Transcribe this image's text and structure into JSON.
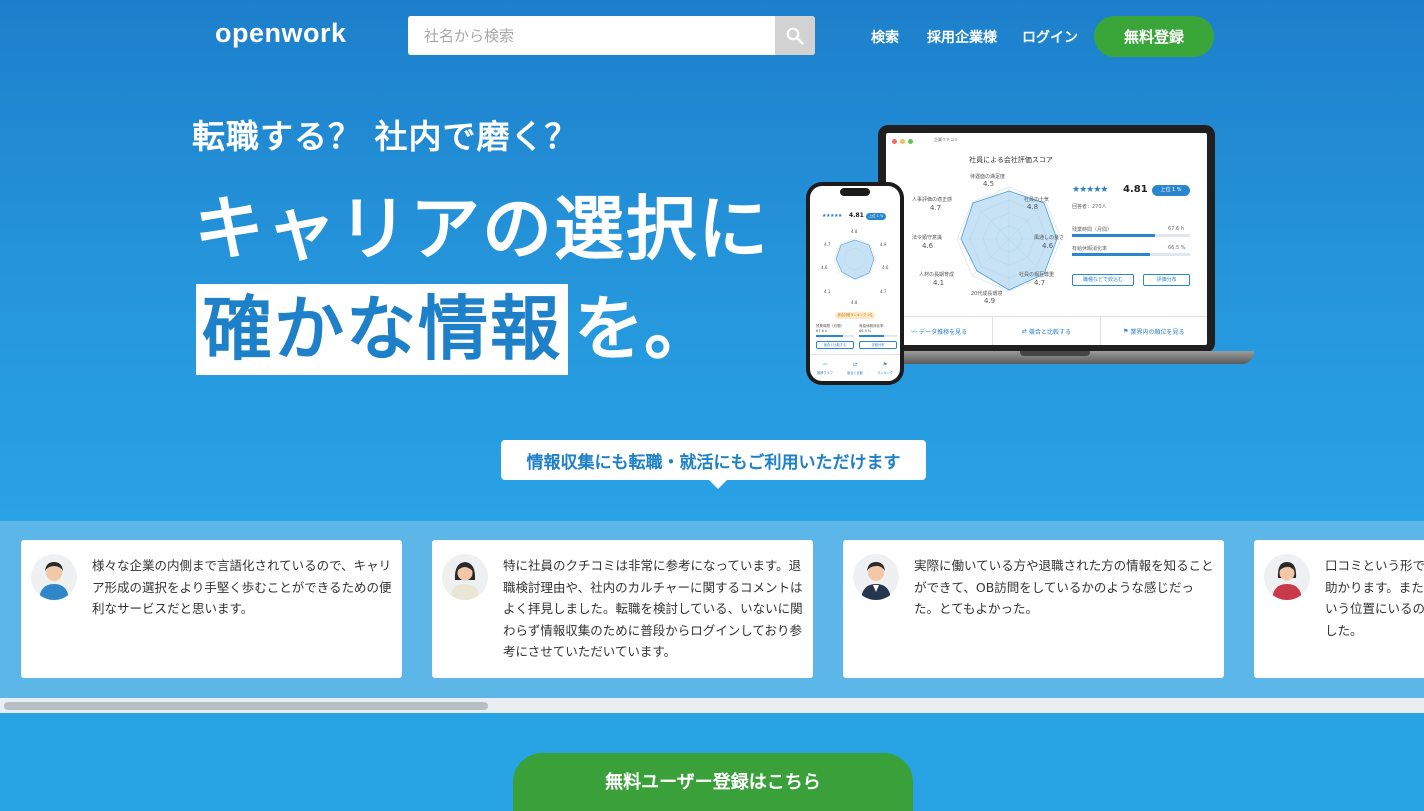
{
  "header": {
    "logo": "openwork",
    "search_placeholder": "社名から検索",
    "nav": [
      "検索",
      "採用企業様",
      "ログイン"
    ],
    "register": "無料登録"
  },
  "hero": {
    "subtitle": "転職する？ 社内で磨く？",
    "line1": "キャリアの選択に",
    "highlight": "確かな情報",
    "line2_suffix": "を。"
  },
  "laptop": {
    "tab": "企業クチコミ",
    "title": "社員による会社評価スコア",
    "radar": [
      {
        "label": "待遇面の満足度",
        "value": "4.5"
      },
      {
        "label": "社員の士気",
        "value": "4.8"
      },
      {
        "label": "風通しの良さ",
        "value": "4.6"
      },
      {
        "label": "社員の相互尊重",
        "value": "4.7"
      },
      {
        "label": "20代成長環境",
        "value": "4.9"
      },
      {
        "label": "人材の長期育成",
        "value": "4.1"
      },
      {
        "label": "法令順守意識",
        "value": "4.6"
      },
      {
        "label": "人事評価の適正感",
        "value": "4.7"
      }
    ],
    "stars": "★★★★★",
    "score": "4.81",
    "badge": "上位 1 %",
    "respondents": "回答者：270人",
    "overtime_label": "残業時間（月間）",
    "overtime_value": "67.6 h",
    "overtime_fill": 0.7,
    "leave_label": "有給休暇消化率",
    "leave_value": "66.5 %",
    "leave_fill": 0.66,
    "btn_compare_job": "職種などで絞込む",
    "btn_distribution": "評価分布",
    "footer": [
      "データ推移を見る",
      "競合と比較する",
      "業界内の順位を見る"
    ]
  },
  "phone": {
    "stars": "★★★★★",
    "score": "4.81",
    "badge": "上位 1 %",
    "radar_values": [
      "4.8",
      "4.9",
      "4.6",
      "4.7",
      "4.8",
      "4.1",
      "4.6",
      "4.7"
    ],
    "pill": "総合評価ランキング 1位",
    "stat1_label": "残業時間（月間）",
    "stat1_value": "67.6 h",
    "stat2_label": "有給休暇消化率",
    "stat2_value": "66.5 %",
    "btn1": "競合と比較する",
    "btn2": "評価分布",
    "tabs": [
      "推移グラフ",
      "競合と比較",
      "ランキング"
    ]
  },
  "callout": "情報収集にも転職・就活にもご利用いただけます",
  "testimonials": [
    {
      "text": "様々な企業の内側まで言語化されているので、キャリア形成の選択をより手堅く歩むことができるための便利なサービスだと思います。",
      "shirt": "#2f86c9",
      "hair": "#2a2a2a"
    },
    {
      "text": "特に社員のクチコミは非常に参考になっています。退職検討理由や、社内のカルチャーに関するコメントはよく拝見しました。転職を検討している、いないに関わらず情報収集のために普段からログインしており参考にさせていただいています。",
      "shirt": "#e9e6d6",
      "hair": "#2a2a2a"
    },
    {
      "text": "実際に働いている方や退職された方の情報を知ることができて、OB訪問をしているかのような感じだった。とてもよかった。",
      "shirt": "#27364f",
      "hair": "#2a2a2a"
    },
    {
      "text": "口コミという形で企業の内情を知ることができるのは助かります。また経歴を登録することで、自身がどういう位置にいるのか分かり、転職活動の参考になりました。",
      "shirt": "#c8394a",
      "hair": "#2a2a2a"
    }
  ],
  "cta": "無料ユーザー登録はこちら"
}
